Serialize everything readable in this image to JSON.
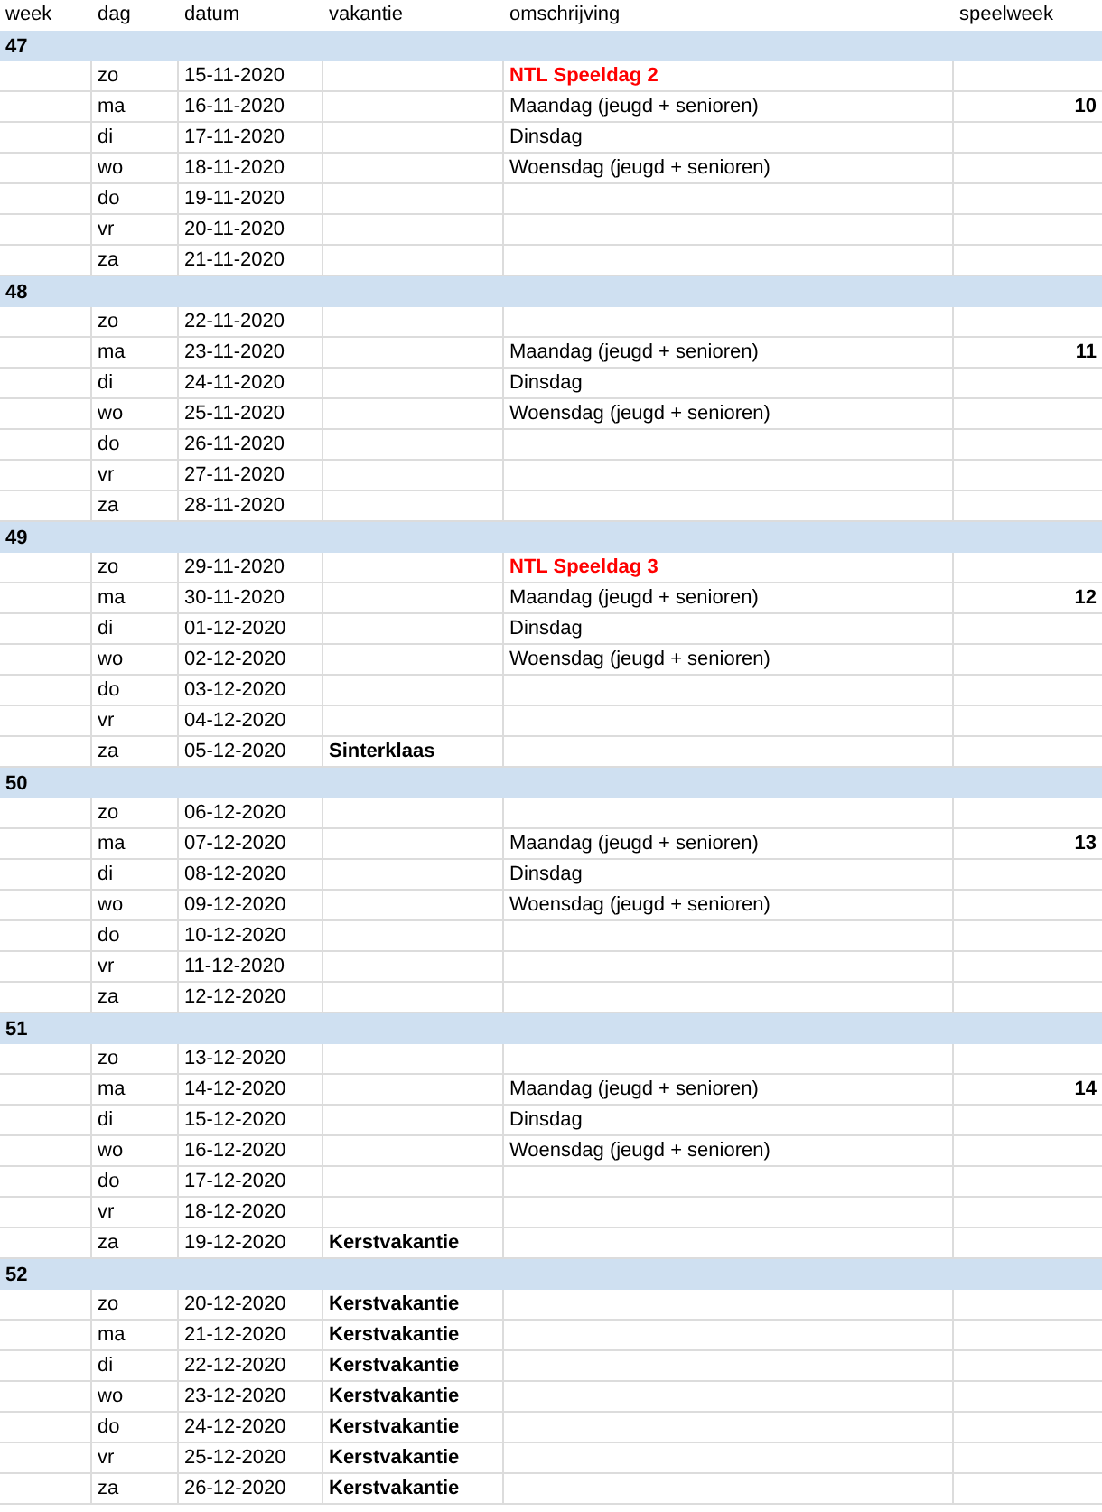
{
  "columns": [
    "week",
    "dag",
    "datum",
    "vakantie",
    "omschrijving",
    "speelweek"
  ],
  "weeks": [
    {
      "week": "47",
      "days": [
        {
          "dag": "zo",
          "datum": "15-11-2020",
          "omschrijving": "NTL Speeldag 2",
          "highlight": true
        },
        {
          "dag": "ma",
          "datum": "16-11-2020",
          "omschrijving": "Maandag (jeugd + senioren)",
          "highlight": false,
          "speelweek": "10"
        },
        {
          "dag": "di",
          "datum": "17-11-2020",
          "omschrijving": "Dinsdag",
          "highlight": false
        },
        {
          "dag": "wo",
          "datum": "18-11-2020",
          "omschrijving": "Woensdag (jeugd + senioren)",
          "highlight": false
        },
        {
          "dag": "do",
          "datum": "19-11-2020"
        },
        {
          "dag": "vr",
          "datum": "20-11-2020"
        },
        {
          "dag": "za",
          "datum": "21-11-2020"
        }
      ]
    },
    {
      "week": "48",
      "days": [
        {
          "dag": "zo",
          "datum": "22-11-2020"
        },
        {
          "dag": "ma",
          "datum": "23-11-2020",
          "omschrijving": "Maandag (jeugd + senioren)",
          "highlight": false,
          "speelweek": "11"
        },
        {
          "dag": "di",
          "datum": "24-11-2020",
          "omschrijving": "Dinsdag",
          "highlight": false
        },
        {
          "dag": "wo",
          "datum": "25-11-2020",
          "omschrijving": "Woensdag (jeugd + senioren)",
          "highlight": false
        },
        {
          "dag": "do",
          "datum": "26-11-2020"
        },
        {
          "dag": "vr",
          "datum": "27-11-2020"
        },
        {
          "dag": "za",
          "datum": "28-11-2020"
        }
      ]
    },
    {
      "week": "49",
      "days": [
        {
          "dag": "zo",
          "datum": "29-11-2020",
          "omschrijving": "NTL Speeldag 3",
          "highlight": true
        },
        {
          "dag": "ma",
          "datum": "30-11-2020",
          "omschrijving": "Maandag (jeugd + senioren)",
          "highlight": false,
          "speelweek": "12"
        },
        {
          "dag": "di",
          "datum": "01-12-2020",
          "omschrijving": "Dinsdag",
          "highlight": false
        },
        {
          "dag": "wo",
          "datum": "02-12-2020",
          "omschrijving": "Woensdag (jeugd + senioren)",
          "highlight": false
        },
        {
          "dag": "do",
          "datum": "03-12-2020"
        },
        {
          "dag": "vr",
          "datum": "04-12-2020"
        },
        {
          "dag": "za",
          "datum": "05-12-2020",
          "vakantie": "Sinterklaas"
        }
      ]
    },
    {
      "week": "50",
      "days": [
        {
          "dag": "zo",
          "datum": "06-12-2020"
        },
        {
          "dag": "ma",
          "datum": "07-12-2020",
          "omschrijving": "Maandag (jeugd + senioren)",
          "highlight": false,
          "speelweek": "13"
        },
        {
          "dag": "di",
          "datum": "08-12-2020",
          "omschrijving": "Dinsdag",
          "highlight": false
        },
        {
          "dag": "wo",
          "datum": "09-12-2020",
          "omschrijving": "Woensdag (jeugd + senioren)",
          "highlight": false
        },
        {
          "dag": "do",
          "datum": "10-12-2020"
        },
        {
          "dag": "vr",
          "datum": "11-12-2020"
        },
        {
          "dag": "za",
          "datum": "12-12-2020"
        }
      ]
    },
    {
      "week": "51",
      "days": [
        {
          "dag": "zo",
          "datum": "13-12-2020"
        },
        {
          "dag": "ma",
          "datum": "14-12-2020",
          "omschrijving": "Maandag (jeugd + senioren)",
          "highlight": false,
          "speelweek": "14"
        },
        {
          "dag": "di",
          "datum": "15-12-2020",
          "omschrijving": "Dinsdag",
          "highlight": false
        },
        {
          "dag": "wo",
          "datum": "16-12-2020",
          "omschrijving": "Woensdag (jeugd + senioren)",
          "highlight": false
        },
        {
          "dag": "do",
          "datum": "17-12-2020"
        },
        {
          "dag": "vr",
          "datum": "18-12-2020"
        },
        {
          "dag": "za",
          "datum": "19-12-2020",
          "vakantie": "Kerstvakantie"
        }
      ]
    },
    {
      "week": "52",
      "days": [
        {
          "dag": "zo",
          "datum": "20-12-2020",
          "vakantie": "Kerstvakantie"
        },
        {
          "dag": "ma",
          "datum": "21-12-2020",
          "vakantie": "Kerstvakantie"
        },
        {
          "dag": "di",
          "datum": "22-12-2020",
          "vakantie": "Kerstvakantie"
        },
        {
          "dag": "wo",
          "datum": "23-12-2020",
          "vakantie": "Kerstvakantie"
        },
        {
          "dag": "do",
          "datum": "24-12-2020",
          "vakantie": "Kerstvakantie"
        },
        {
          "dag": "vr",
          "datum": "25-12-2020",
          "vakantie": "Kerstvakantie"
        },
        {
          "dag": "za",
          "datum": "26-12-2020",
          "vakantie": "Kerstvakantie"
        }
      ]
    }
  ]
}
